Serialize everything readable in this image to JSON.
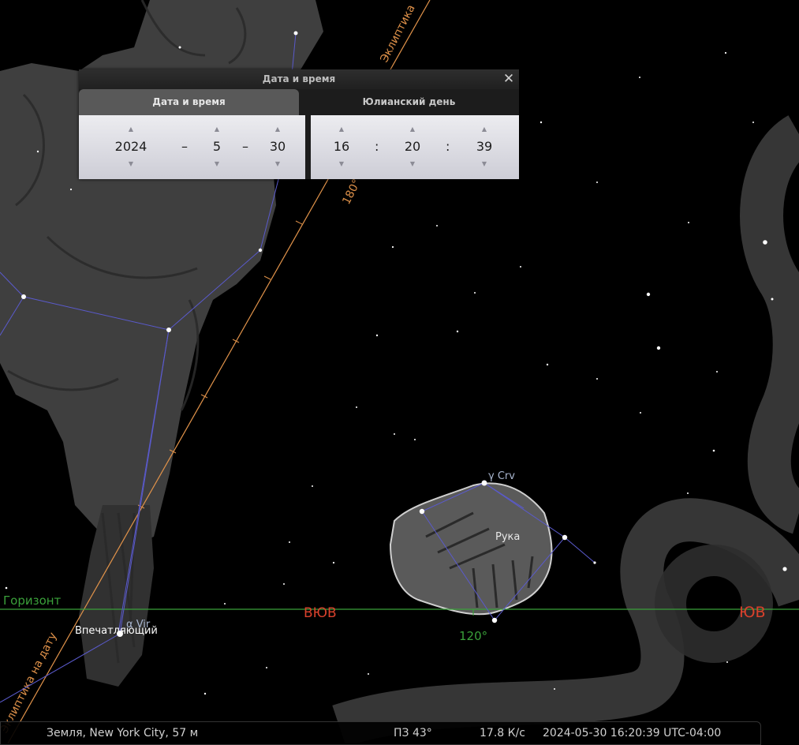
{
  "sky": {
    "ecliptic_label": "Эклиптика",
    "ecliptic_of_date_label": "Эклиптика на дату",
    "ecliptic_degree_label": "180°",
    "horizon_label": "Горизонт",
    "compass_sse": "ВЮВ",
    "compass_se": "ЮВ",
    "azimuth_label": "120°",
    "star_gamma_crv": "γ Crv",
    "star_alpha_vir": "α Vir",
    "asterism_hand": "Рука",
    "star_vindemiatrix": "Впечатляющий",
    "colors": {
      "ecliptic": "#e0924a",
      "horizon": "#3aa03a",
      "compass": "#d9412c",
      "constellation_lines": "#5a5acc",
      "labels": "#a9b6cf"
    }
  },
  "dialog": {
    "title": "Дата и время",
    "tabs": [
      {
        "label": "Дата и время",
        "active": true
      },
      {
        "label": "Юлианский день",
        "active": false
      }
    ],
    "date": {
      "year": "2024",
      "month": "5",
      "day": "30",
      "separator": "–"
    },
    "time": {
      "hour": "16",
      "minute": "20",
      "second": "39",
      "separator": ":"
    }
  },
  "status": {
    "location": "Земля, New York City, 57 м",
    "fov": "ПЗ 43°",
    "fps": "17.8 К/с",
    "datetime": "2024-05-30 16:20:39 UTC-04:00"
  }
}
